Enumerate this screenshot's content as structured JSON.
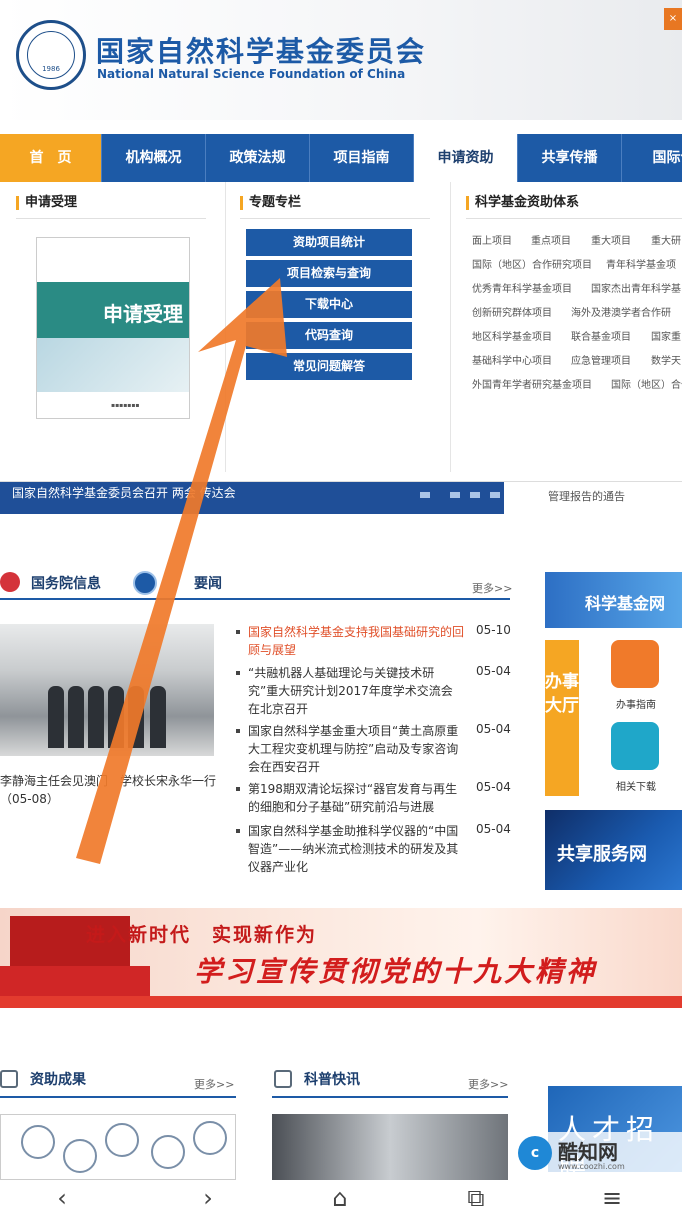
{
  "header": {
    "title_cn": "国家自然科学基金委员会",
    "title_en": "National Natural Science Foundation of China",
    "logo_year": "1986"
  },
  "nav": {
    "items": [
      {
        "label": "首　页"
      },
      {
        "label": "机构概况"
      },
      {
        "label": "政策法规"
      },
      {
        "label": "项目指南"
      },
      {
        "label": "申请资助"
      },
      {
        "label": "共享传播"
      },
      {
        "label": "国际合"
      }
    ],
    "active_index": 4
  },
  "dropdown": {
    "col1_title": "申请受理",
    "cover_text": "申请受理",
    "col2_title": "专题专栏",
    "buttons": [
      {
        "label": "资助项目统计"
      },
      {
        "label": "项目检索与查询"
      },
      {
        "label": "下载中心"
      },
      {
        "label": "代码查询"
      },
      {
        "label": "常见问题解答"
      }
    ],
    "col3_title": "科学基金资助体系",
    "funding_rows": [
      [
        "面上项目",
        "重点项目",
        "重大项目",
        "重大研"
      ],
      [
        "国际（地区）合作研究项目",
        "青年科学基金项"
      ],
      [
        "优秀青年科学基金项目",
        "国家杰出青年科学基"
      ],
      [
        "创新研究群体项目",
        "海外及港澳学者合作研"
      ],
      [
        "地区科学基金项目",
        "联合基金项目",
        "国家重"
      ],
      [
        "基础科学中心项目",
        "应急管理项目",
        "数学天"
      ],
      [
        "外国青年学者研究基金项目",
        "国际（地区）合作"
      ]
    ]
  },
  "strip": {
    "text": "国家自然科学基金委员会召开 两会 传达会",
    "side_notice": "管理报告的通告"
  },
  "news": {
    "tab1": "国务院信息",
    "tab2": "要闻",
    "more": "更多>>",
    "photo_caption": "李静海主任会见澳门　学校长宋永华一行（05-08）",
    "items": [
      {
        "title": "国家自然科学基金支持我国基础研究的回顾与展望",
        "date": "05-10"
      },
      {
        "title": "“共融机器人基础理论与关键技术研究”重大研究计划2017年度学术交流会在北京召开",
        "date": "05-04"
      },
      {
        "title": "国家自然科学基金重大项目“黄土高原重大工程灾变机理与防控”启动及专家咨询会在西安召开",
        "date": "05-04"
      },
      {
        "title": "第198期双清论坛探讨“器官发育与再生的细胞和分子基础”研究前沿与进展",
        "date": "05-04"
      },
      {
        "title": "国家自然科学基金助推科学仪器的“中国智造”——纳米流式检测技术的研发及其仪器产业化",
        "date": "05-04"
      }
    ]
  },
  "sidebar": {
    "banner_text": "科学基金网",
    "service_hall": "办事大厅",
    "guide_label": "办事指南",
    "download_label": "相关下载",
    "share_text": "共享服务网",
    "talent_text": "人才招聘"
  },
  "banner": {
    "line1": "进入新时代　实现新作为",
    "line2": "学习宣传贯彻党的十九大精神"
  },
  "bottom": {
    "sec1_title": "资助成果",
    "sec2_title": "科普快讯",
    "more": "更多>>"
  },
  "watermark": {
    "name": "酷知网",
    "url": "www.coozhi.com",
    "badge": "c"
  },
  "system_nav": {
    "back": "‹",
    "forward": "›",
    "home": "⌂",
    "tabs": "⧉",
    "menu": "≡"
  },
  "colors": {
    "primary": "#1d5aa6",
    "accent": "#f5a623",
    "highlight_news": "#e0502a",
    "annotation_arrow": "#f07a2a"
  }
}
